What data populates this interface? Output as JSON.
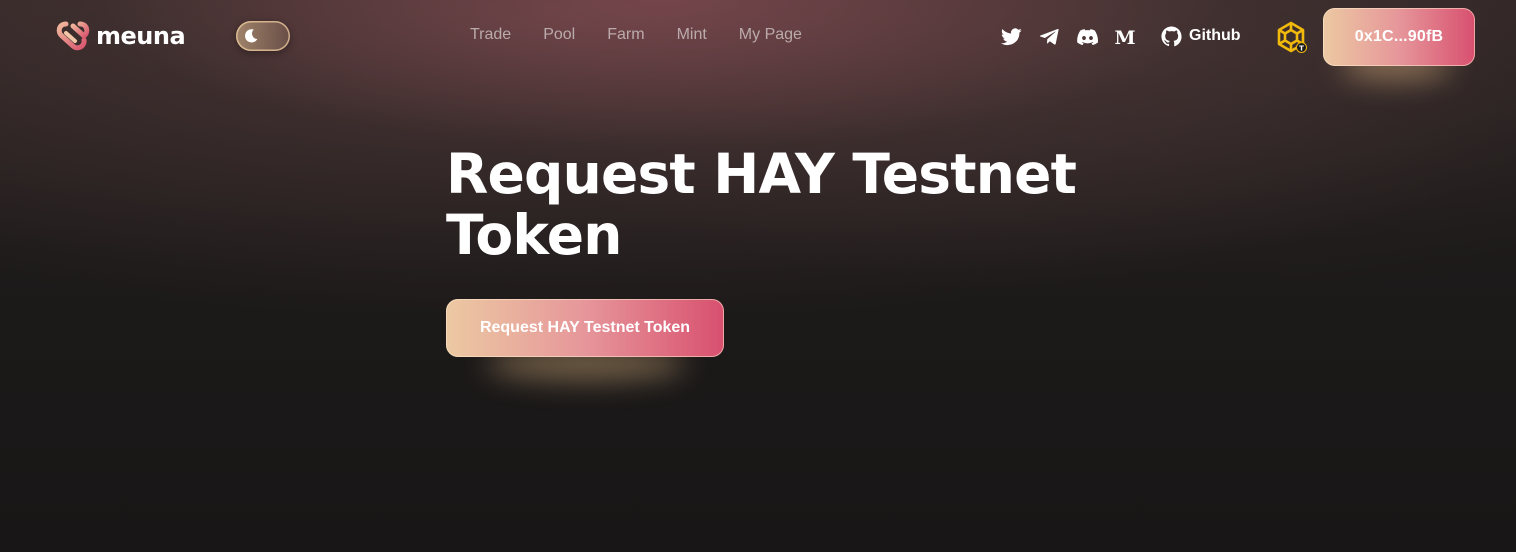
{
  "brand": {
    "name": "meuna",
    "logo_icon": "meuna-logo-icon",
    "accent": "#d8506f",
    "accent_light": "#ecc9a2"
  },
  "theme_toggle": {
    "icon": "moon-icon",
    "mode": "dark"
  },
  "nav": {
    "items": [
      {
        "label": "Trade"
      },
      {
        "label": "Pool"
      },
      {
        "label": "Farm"
      },
      {
        "label": "Mint"
      },
      {
        "label": "My Page"
      }
    ]
  },
  "socials": [
    {
      "icon": "twitter-icon"
    },
    {
      "icon": "telegram-icon"
    },
    {
      "icon": "discord-icon"
    },
    {
      "icon": "medium-icon"
    }
  ],
  "github": {
    "label": "Github",
    "icon": "github-icon"
  },
  "network": {
    "icon": "bnb-chain-icon",
    "badge_text": "T"
  },
  "wallet": {
    "label": "0x1C...90fB"
  },
  "hero": {
    "title": "Request HAY Testnet Token",
    "button_label": "Request HAY Testnet Token"
  }
}
